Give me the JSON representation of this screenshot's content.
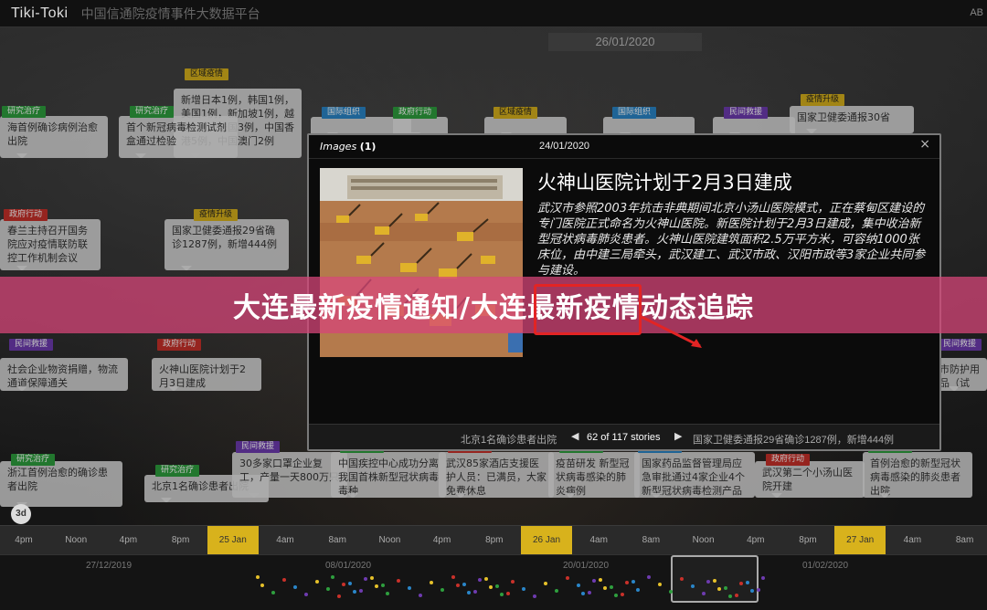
{
  "app": {
    "brand": "Tiki-Toki",
    "site_title": "中国信通院疫情事件大数据平台",
    "topbar_right": "AB"
  },
  "current_date": "26/01/2020",
  "cards": [
    {
      "tag": "区域疫情",
      "tag_color": "yellow",
      "text": "新增日本1例，韩国1例，美国1例，新加坡1例，越南1例，法国3例，中国香港5例，中国澳门2例"
    },
    {
      "tag": "研究治疗",
      "tag_color": "green",
      "text": "海首例确诊病例治愈出院"
    },
    {
      "tag": "研究治疗",
      "tag_color": "green",
      "text": "首个新冠病毒检测试剂盒通过检验"
    },
    {
      "tag": "国际组织",
      "tag_color": "blue",
      "text": ""
    },
    {
      "tag": "政府行动",
      "tag_color": "green",
      "text": ""
    },
    {
      "tag": "区域疫情",
      "tag_color": "yellow",
      "text": ""
    },
    {
      "tag": "国际组织",
      "tag_color": "blue",
      "text": ""
    },
    {
      "tag": "民间救援",
      "tag_color": "purple",
      "text": ""
    },
    {
      "tag": "疫情升级",
      "tag_color": "yellow",
      "text": "国家卫健委通报30省"
    },
    {
      "tag": "政府行动",
      "tag_color": "red",
      "text": "春兰主持召开国务院应对疫情联防联控工作机制会议"
    },
    {
      "tag": "疫情升级",
      "tag_color": "yellow",
      "text": "国家卫健委通报29省确诊1287例，新增444例"
    },
    {
      "tag": "民间救援",
      "tag_color": "purple",
      "text": "社会企业物资捐赠，物流通道保障通关"
    },
    {
      "tag": "政府行动",
      "tag_color": "red",
      "text": "火神山医院计划于2月3日建成"
    },
    {
      "tag": "民间救援",
      "tag_color": "purple",
      "text": "市防护用品（试行）"
    },
    {
      "tag": "研究治疗",
      "tag_color": "green",
      "text": "浙江首例治愈的确诊患者出院"
    },
    {
      "tag": "研究治疗",
      "tag_color": "green",
      "text": "北京1名确诊患者出院"
    },
    {
      "tag": "民间救援",
      "tag_color": "purple",
      "text": "30多家口罩企业复工，产量一天800万只"
    },
    {
      "tag": "研究治疗",
      "tag_color": "green",
      "text": "中国疾控中心成功分离我国首株新型冠状病毒毒种"
    },
    {
      "tag": "政府行动",
      "tag_color": "red",
      "text": "武汉85家酒店支援医护人员：已满员，大家免费休息"
    },
    {
      "tag": "研究治疗",
      "tag_color": "green",
      "text": "疫苗研发  新型冠状病毒感染的肺炎病例"
    },
    {
      "tag": "政府行动",
      "tag_color": "blue",
      "text": "国家药品监督管理局应急审批通过4家企业4个新型冠状病毒检测产品"
    },
    {
      "tag": "政府行动",
      "tag_color": "red",
      "text": "武汉第二个小汤山医院开建"
    },
    {
      "tag": "研究治疗",
      "tag_color": "green",
      "text": "首例治愈的新型冠状病毒感染的肺炎患者出院"
    }
  ],
  "modal": {
    "images_label": "Images",
    "images_count": "(1)",
    "date": "24/01/2020",
    "close": "×",
    "title": "火神山医院计划于2月3日建成",
    "body": "武汉市参照2003年抗击非典期间北京小汤山医院模式，正在蔡甸区建设的专门医院正式命名为火神山医院。新医院计划于2月3日建成，集中收治新型冠状病毒肺炎患者。火神山医院建筑面积2.5万平方米，可容纳1000张床位，由中建三局牵头，武汉建工、武汉市政、汉阳市政等3家企业共同参与建设。",
    "prev_story": "北京1名确诊患者出院",
    "counter": "62 of 117 stories",
    "next_story": "国家卫健委通报29省确诊1287例，新增444例",
    "prev_icon": "◀",
    "next_icon": "▶"
  },
  "banner": {
    "text": "大连最新疫情通知/大连最新疫情动态追踪"
  },
  "axis": {
    "ticks": [
      {
        "label": "4pm",
        "hl": false
      },
      {
        "label": "Noon",
        "hl": false
      },
      {
        "label": "4pm",
        "hl": false
      },
      {
        "label": "8pm",
        "hl": false
      },
      {
        "label": "25 Jan",
        "hl": true
      },
      {
        "label": "4am",
        "hl": false
      },
      {
        "label": "8am",
        "hl": false
      },
      {
        "label": "Noon",
        "hl": false
      },
      {
        "label": "4pm",
        "hl": false
      },
      {
        "label": "8pm",
        "hl": false
      },
      {
        "label": "26 Jan",
        "hl": true
      },
      {
        "label": "4am",
        "hl": false
      },
      {
        "label": "8am",
        "hl": false
      },
      {
        "label": "Noon",
        "hl": false
      },
      {
        "label": "4pm",
        "hl": false
      },
      {
        "label": "8pm",
        "hl": false
      },
      {
        "label": "27 Jan",
        "hl": true
      },
      {
        "label": "4am",
        "hl": false
      },
      {
        "label": "8am",
        "hl": false
      },
      {
        "label": "Noon",
        "hl": false
      }
    ],
    "zoom_badge": "3d"
  },
  "minimap": {
    "dates": [
      "27/12/2019",
      "08/01/2020",
      "20/01/2020",
      "01/02/2020"
    ]
  }
}
